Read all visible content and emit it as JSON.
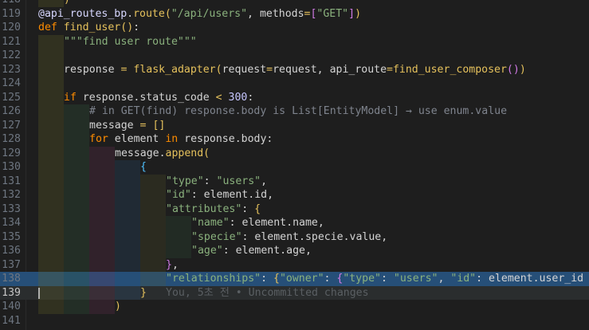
{
  "editor": {
    "active_line": "139",
    "lines": [
      {
        "n": "118",
        "code": ")"
      },
      {
        "n": "119",
        "code": "@api_routes_bp.route(\"/api/users\", methods=[\"GET\"])"
      },
      {
        "n": "120",
        "code": "def find_user():"
      },
      {
        "n": "121",
        "code": "\"\"\"find user route\"\"\""
      },
      {
        "n": "122",
        "code": ""
      },
      {
        "n": "123",
        "code": "response = flask_adapter(request=request, api_route=find_user_composer())"
      },
      {
        "n": "124",
        "code": ""
      },
      {
        "n": "125",
        "code": "if response.status_code < 300:"
      },
      {
        "n": "126",
        "code": "# in GET(find) response.body is List[EntityModel] → use enum.value"
      },
      {
        "n": "127",
        "code": "message = []"
      },
      {
        "n": "128",
        "code": "for element in response.body:"
      },
      {
        "n": "129",
        "code": "message.append("
      },
      {
        "n": "130",
        "code": "{"
      },
      {
        "n": "131",
        "code": "\"type\": \"users\","
      },
      {
        "n": "132",
        "code": "\"id\": element.id,"
      },
      {
        "n": "133",
        "code": "\"attributes\": {"
      },
      {
        "n": "134",
        "code": "\"name\": element.name,"
      },
      {
        "n": "135",
        "code": "\"specie\": element.specie.value,"
      },
      {
        "n": "136",
        "code": "\"age\": element.age,"
      },
      {
        "n": "137",
        "code": "},"
      },
      {
        "n": "138",
        "code": "\"relationships\": {\"owner\": {\"type\": \"users\", \"id\": element.user_id"
      },
      {
        "n": "139",
        "code": "}"
      },
      {
        "n": "140",
        "code": ")"
      },
      {
        "n": "141",
        "code": ""
      }
    ],
    "blame": "You, 5초 전 • Uncommitted changes"
  }
}
